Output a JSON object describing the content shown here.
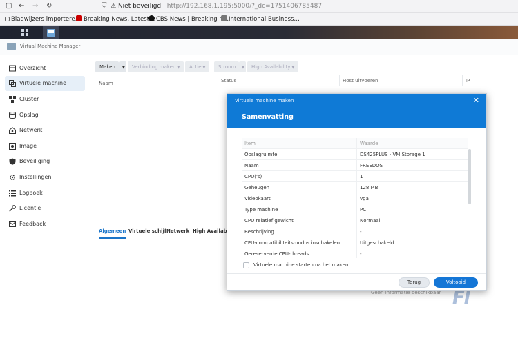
{
  "browser": {
    "security_label": "Niet beveiligd",
    "url_host": "http://192.168.1.195",
    "url_rest": ":5000/?_dc=1751406785487",
    "bookmarks": [
      "Bladwijzers importere…",
      "Breaking News, Latest…",
      "CBS News | Breaking n…",
      "International Business…"
    ]
  },
  "app": {
    "title": "Virtual Machine Manager"
  },
  "sidebar": {
    "items": [
      {
        "label": "Overzicht",
        "icon": "overview-icon"
      },
      {
        "label": "Virtuele machine",
        "icon": "virtual-machine-icon"
      },
      {
        "label": "Cluster",
        "icon": "cluster-icon"
      },
      {
        "label": "Opslag",
        "icon": "storage-icon"
      },
      {
        "label": "Netwerk",
        "icon": "network-icon"
      },
      {
        "label": "Image",
        "icon": "image-icon"
      },
      {
        "label": "Beveiliging",
        "icon": "shield-icon"
      },
      {
        "label": "Instellingen",
        "icon": "gear-icon"
      },
      {
        "label": "Logboek",
        "icon": "list-icon"
      },
      {
        "label": "Licentie",
        "icon": "key-icon"
      },
      {
        "label": "Feedback",
        "icon": "mail-icon"
      }
    ],
    "selected": "Virtuele machine"
  },
  "toolbar": {
    "create": "Maken",
    "connection": "Verbinding maken",
    "action": "Actie",
    "power": "Stroom",
    "ha": "High Availability"
  },
  "grid": {
    "columns": [
      "Naam",
      "Status",
      "Host uitvoeren",
      "IP"
    ]
  },
  "lower_tabs": [
    "Algemeen",
    "Virtuele schijf",
    "Netwerk",
    "High Availability"
  ],
  "empty_text": "Geen informatie beschikbaar",
  "dialog": {
    "title": "Virtuele machine maken",
    "subtitle": "Samenvatting",
    "table_headers": [
      "Item",
      "Waarde"
    ],
    "rows": [
      [
        "Opslagruimte",
        "DS425PLUS - VM Storage 1"
      ],
      [
        "Naam",
        "FREEDOS"
      ],
      [
        "CPU('s)",
        "1"
      ],
      [
        "Geheugen",
        "128 MB"
      ],
      [
        "Videokaart",
        "vga"
      ],
      [
        "Type machine",
        "PC"
      ],
      [
        "CPU relatief gewicht",
        "Normaal"
      ],
      [
        "Beschrijving",
        "-"
      ],
      [
        "CPU-compatibiliteitsmodus inschakelen",
        "Uitgeschakeld"
      ],
      [
        "Gereserverde CPU-threads",
        "-"
      ]
    ],
    "checkbox_label": "Virtuele machine starten na het maken",
    "back": "Terug",
    "done": "Voltooid"
  },
  "watermark": "FI"
}
